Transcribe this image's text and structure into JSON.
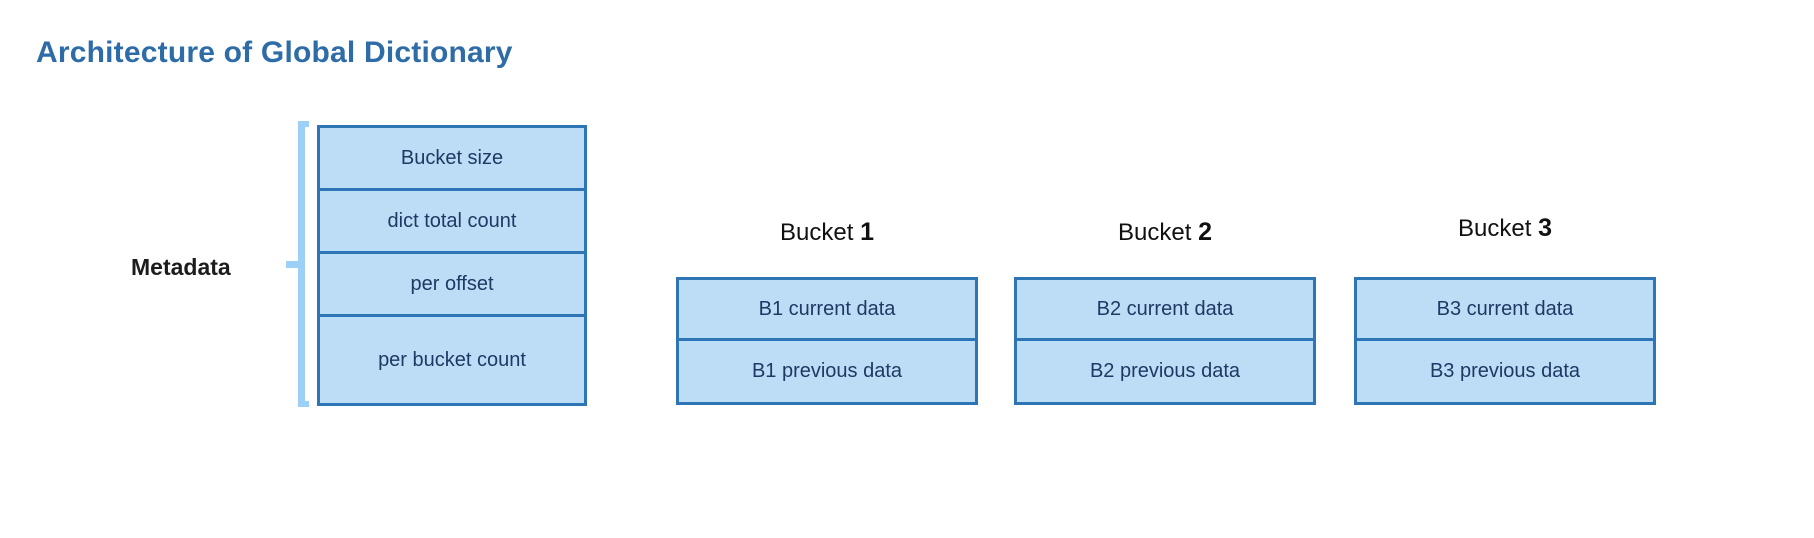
{
  "page": {
    "title": "Architecture of Global Dictionary",
    "background_color": "#FFFFFF",
    "title_color": "#2E6CA8",
    "box_border_color": "#2E75B6",
    "box_fill_color": "#BDDDF7",
    "box_text_color": "#1F3864",
    "brace_color": "#9CD0F7"
  },
  "metadata": {
    "label": "Metadata",
    "rows": [
      {
        "label": "Bucket size"
      },
      {
        "label": "dict total count"
      },
      {
        "label": "per offset"
      },
      {
        "label": "per bucket count"
      }
    ]
  },
  "buckets": [
    {
      "title_prefix": "Bucket",
      "index": "1",
      "rows": [
        {
          "label": "B1 current data"
        },
        {
          "label": "B1 previous data"
        }
      ]
    },
    {
      "title_prefix": "Bucket",
      "index": "2",
      "rows": [
        {
          "label": "B2 current data"
        },
        {
          "label": "B2 previous data"
        }
      ]
    },
    {
      "title_prefix": "Bucket",
      "index": "3",
      "rows": [
        {
          "label": "B3 current data"
        },
        {
          "label": "B3 previous data"
        }
      ]
    }
  ]
}
